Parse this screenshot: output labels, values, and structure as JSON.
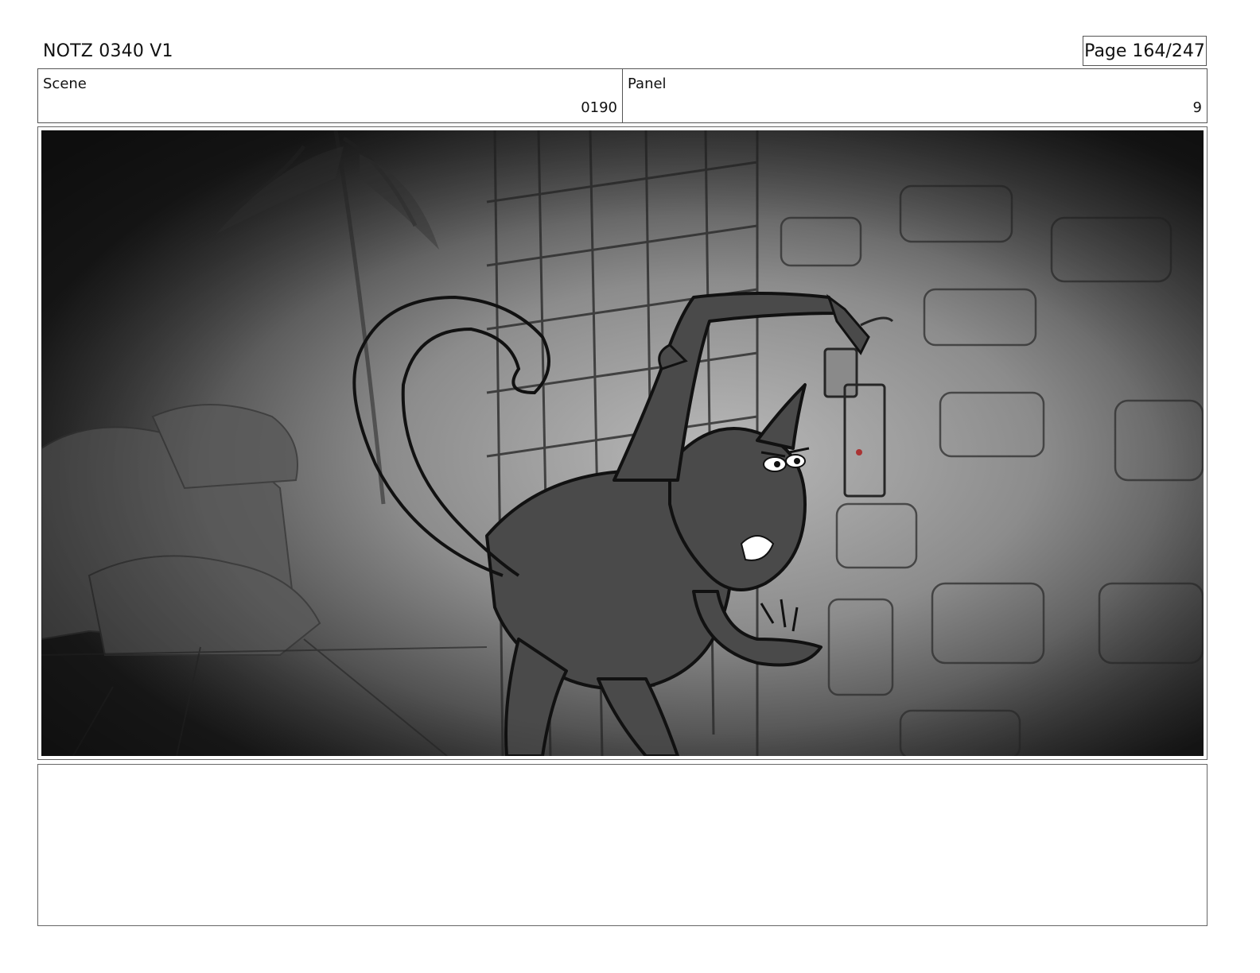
{
  "header": {
    "title": "NOTZ 0340 V1",
    "page": "Page 164/247"
  },
  "info": {
    "scene_label": "Scene",
    "scene_value": "0190",
    "panel_label": "Panel",
    "panel_value": "9"
  },
  "notes": {
    "text": ""
  }
}
